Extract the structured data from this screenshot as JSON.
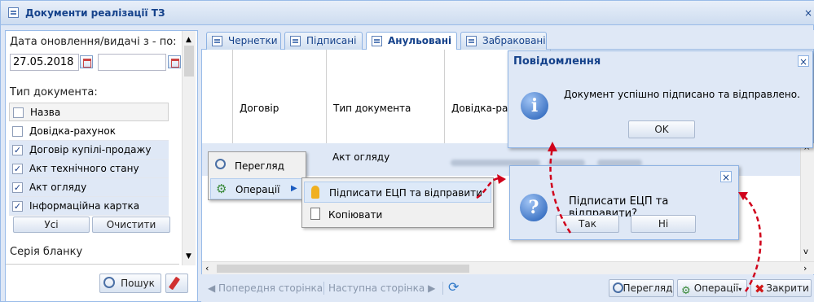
{
  "window": {
    "title": "Документи реалізації ТЗ",
    "icon": "window-icon",
    "close_icon": "close-icon"
  },
  "filters": {
    "date_label": "Дата оновлення/видачі з - по:",
    "date_from": "27.05.2018",
    "date_to": "",
    "doctype_label": "Тип документа:",
    "doctype_header": "Назва",
    "doctypes": [
      {
        "label": "Довідка-рахунок",
        "checked": false
      },
      {
        "label": "Договір купілі-продажу",
        "checked": true
      },
      {
        "label": "Акт технічного стану",
        "checked": true
      },
      {
        "label": "Акт огляду",
        "checked": true
      },
      {
        "label": "Інформаційна картка",
        "checked": true
      }
    ],
    "all_button": "Усі",
    "clear_button": "Очистити",
    "series_label": "Серія бланку",
    "search_button": "Пошук",
    "reset_icon": "eraser-icon"
  },
  "tabs": [
    {
      "label": "Чернетки",
      "active": false
    },
    {
      "label": "Підписані",
      "active": false
    },
    {
      "label": "Анульовані",
      "active": true
    },
    {
      "label": "Забраковані",
      "active": false
    }
  ],
  "grid": {
    "columns": [
      "Договір",
      "Тип документа",
      "Довідка-рах"
    ],
    "row_doc_type": "Акт огляду"
  },
  "context_menu": {
    "items": [
      "Перегляд",
      "Операції"
    ],
    "submenu": [
      "Підписати ЕЦП та відправити",
      "Копіювати"
    ]
  },
  "pager": {
    "prev": "Попередня сторінка",
    "next": "Наступна сторінка"
  },
  "toolbar": {
    "view": "Перегляд",
    "operations": "Операції",
    "close": "Закрити"
  },
  "message_dialog": {
    "title": "Повідомлення",
    "text": "Документ успішно підписано та відправлено.",
    "ok": "OK"
  },
  "confirm_dialog": {
    "question": "Підписати ЕЦП та відправити?",
    "yes": "Так",
    "no": "Ні"
  },
  "colors": {
    "accent": "#15428b",
    "arrow": "#d0021b",
    "panel": "#dfe8f6"
  }
}
